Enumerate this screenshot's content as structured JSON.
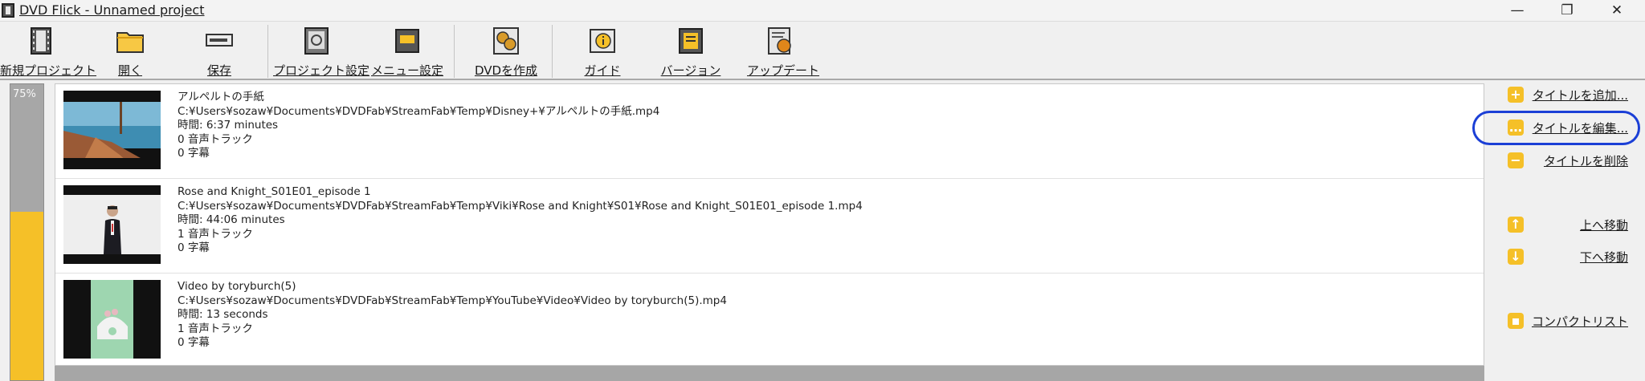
{
  "window": {
    "title": "DVD Flick - Unnamed project"
  },
  "toolbar": {
    "new_project": "新規プロジェクト",
    "open": "開く",
    "save": "保存",
    "project_settings": "プロジェクト設定",
    "menu_settings": "メニュー設定",
    "create_dvd": "DVDを作成",
    "guide": "ガイド",
    "version": "バージョン",
    "update": "アップデート"
  },
  "progress": {
    "text": "75%",
    "fill_fraction": 0.57
  },
  "titles": [
    {
      "name": "アルペルトの手紙",
      "path": "C:¥Users¥sozaw¥Documents¥DVDFab¥StreamFab¥Temp¥Disney+¥アルペルトの手紙.mp4",
      "duration": "時間: 6:37 minutes",
      "audio": "0 音声トラック",
      "subtitles": "0 字幕"
    },
    {
      "name": "Rose and Knight_S01E01_episode 1",
      "path": "C:¥Users¥sozaw¥Documents¥DVDFab¥StreamFab¥Temp¥Viki¥Rose and Knight¥S01¥Rose and Knight_S01E01_episode 1.mp4",
      "duration": "時間: 44:06 minutes",
      "audio": "1 音声トラック",
      "subtitles": "0 字幕"
    },
    {
      "name": "Video by toryburch(5)",
      "path": "C:¥Users¥sozaw¥Documents¥DVDFab¥StreamFab¥Temp¥YouTube¥Video¥Video by toryburch(5).mp4",
      "duration": "時間: 13 seconds",
      "audio": "1 音声トラック",
      "subtitles": "0 字幕"
    }
  ],
  "side": {
    "add": "タイトルを追加...",
    "edit": "タイトルを編集...",
    "delete": "タイトルを削除",
    "move_up": "上へ移動",
    "move_down": "下へ移動",
    "compact_list": "コンパクトリスト"
  },
  "colors": {
    "accent_yellow": "#f5c028",
    "highlight_blue": "#1b3fd6"
  }
}
